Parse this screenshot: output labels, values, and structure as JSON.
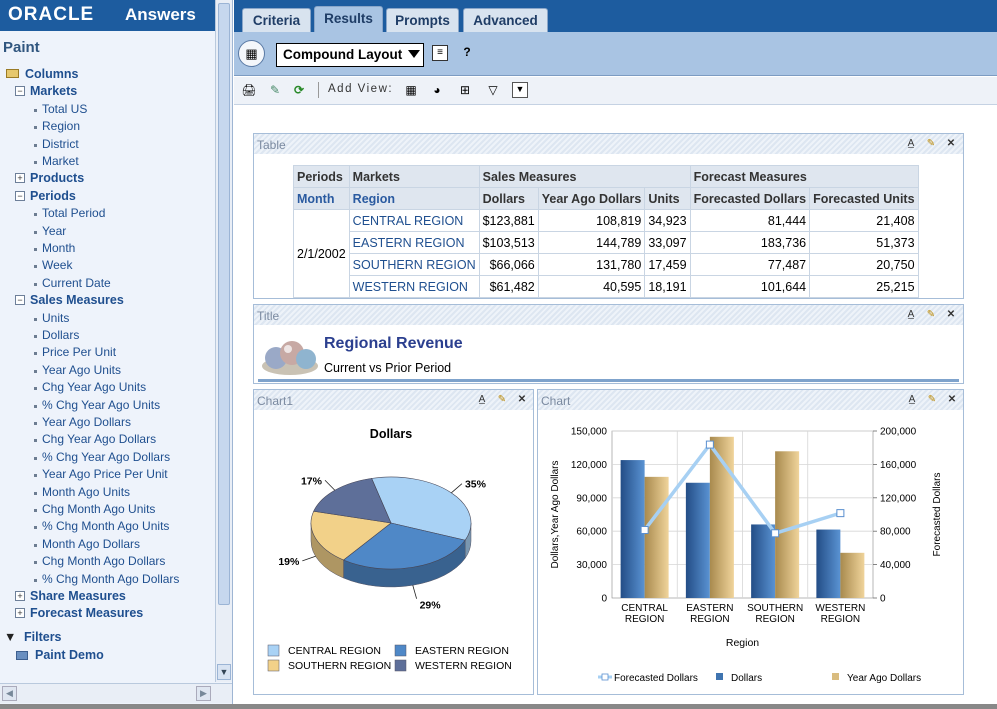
{
  "brand": {
    "oracle": "ORACLE",
    "product": "Answers"
  },
  "subject_area": "Paint",
  "tree": [
    {
      "label": "Columns",
      "level": 0,
      "kind": "folder"
    },
    {
      "label": "Markets",
      "level": 1,
      "kind": "minus"
    },
    {
      "label": "Total US",
      "level": 2,
      "kind": "leaf"
    },
    {
      "label": "Region",
      "level": 2,
      "kind": "leaf"
    },
    {
      "label": "District",
      "level": 2,
      "kind": "leaf"
    },
    {
      "label": "Market",
      "level": 2,
      "kind": "leaf"
    },
    {
      "label": "Products",
      "level": 1,
      "kind": "plus"
    },
    {
      "label": "Periods",
      "level": 1,
      "kind": "minus"
    },
    {
      "label": "Total Period",
      "level": 2,
      "kind": "leaf"
    },
    {
      "label": "Year",
      "level": 2,
      "kind": "leaf"
    },
    {
      "label": "Month",
      "level": 2,
      "kind": "leaf"
    },
    {
      "label": "Week",
      "level": 2,
      "kind": "leaf"
    },
    {
      "label": "Current Date",
      "level": 2,
      "kind": "leaf"
    },
    {
      "label": "Sales Measures",
      "level": 1,
      "kind": "minus"
    },
    {
      "label": "Units",
      "level": 2,
      "kind": "leaf"
    },
    {
      "label": "Dollars",
      "level": 2,
      "kind": "leaf"
    },
    {
      "label": "Price Per Unit",
      "level": 2,
      "kind": "leaf"
    },
    {
      "label": "Year Ago Units",
      "level": 2,
      "kind": "leaf"
    },
    {
      "label": "Chg Year Ago Units",
      "level": 2,
      "kind": "leaf"
    },
    {
      "label": "% Chg Year Ago Units",
      "level": 2,
      "kind": "leaf"
    },
    {
      "label": "Year Ago Dollars",
      "level": 2,
      "kind": "leaf"
    },
    {
      "label": "Chg Year Ago Dollars",
      "level": 2,
      "kind": "leaf"
    },
    {
      "label": "% Chg Year Ago Dollars",
      "level": 2,
      "kind": "leaf"
    },
    {
      "label": "Year Ago Price Per Unit",
      "level": 2,
      "kind": "leaf"
    },
    {
      "label": "Month Ago Units",
      "level": 2,
      "kind": "leaf"
    },
    {
      "label": "Chg Month Ago Units",
      "level": 2,
      "kind": "leaf"
    },
    {
      "label": "% Chg Month Ago Units",
      "level": 2,
      "kind": "leaf"
    },
    {
      "label": "Month Ago Dollars",
      "level": 2,
      "kind": "leaf"
    },
    {
      "label": "Chg Month Ago Dollars",
      "level": 2,
      "kind": "leaf"
    },
    {
      "label": "% Chg Month Ago Dollars",
      "level": 2,
      "kind": "leaf"
    },
    {
      "label": "Share Measures",
      "level": 1,
      "kind": "plus"
    },
    {
      "label": "Forecast Measures",
      "level": 1,
      "kind": "plus"
    }
  ],
  "filters": {
    "label": "Filters",
    "item": "Paint Demo"
  },
  "tabs": [
    "Criteria",
    "Results",
    "Prompts",
    "Advanced"
  ],
  "active_tab": "Results",
  "layout_select": "Compound Layout",
  "add_view_label": "Add View:",
  "table_view": {
    "title": "Table",
    "header1": [
      "Periods",
      "Markets",
      "Sales Measures",
      "Forecast Measures"
    ],
    "header2": [
      "Month",
      "Region",
      "Dollars",
      "Year Ago Dollars",
      "Units",
      "Forecasted Dollars",
      "Forecasted Units"
    ],
    "period": "2/1/2002",
    "rows": [
      {
        "region": "CENTRAL REGION",
        "dollars": "$123,881",
        "yad": "108,819",
        "units": "34,923",
        "fd": "81,444",
        "fu": "21,408"
      },
      {
        "region": "EASTERN REGION",
        "dollars": "$103,513",
        "yad": "144,789",
        "units": "33,097",
        "fd": "183,736",
        "fu": "51,373"
      },
      {
        "region": "SOUTHERN REGION",
        "dollars": "$66,066",
        "yad": "131,780",
        "units": "17,459",
        "fd": "77,487",
        "fu": "20,750"
      },
      {
        "region": "WESTERN REGION",
        "dollars": "$61,482",
        "yad": "40,595",
        "units": "18,191",
        "fd": "101,644",
        "fu": "25,215"
      }
    ]
  },
  "title_view": {
    "title": "Title",
    "main": "Regional Revenue",
    "sub": "Current vs Prior Period"
  },
  "chart1_title": "Chart1",
  "chart2_title": "Chart",
  "colors": {
    "central": "#a9d2f5",
    "eastern": "#4f88c7",
    "southern": "#f2d189",
    "western": "#5e6f99",
    "line": "#a7d0f3",
    "dollars": "#3f74b0",
    "yago": "#d9bc7f"
  },
  "chart_data": [
    {
      "type": "pie",
      "title": "Dollars",
      "labels": [
        "CENTRAL REGION",
        "EASTERN REGION",
        "SOUTHERN REGION",
        "WESTERN REGION"
      ],
      "values": [
        35,
        29,
        19,
        17
      ],
      "value_labels": [
        "35%",
        "29%",
        "19%",
        "17%"
      ],
      "legend": "bottom"
    },
    {
      "type": "bar",
      "categories": [
        "CENTRAL REGION",
        "EASTERN REGION",
        "SOUTHERN REGION",
        "WESTERN REGION"
      ],
      "series": [
        {
          "name": "Dollars",
          "values": [
            123881,
            103513,
            66066,
            61482
          ],
          "axis": "left"
        },
        {
          "name": "Year Ago Dollars",
          "values": [
            108819,
            144789,
            131780,
            40595
          ],
          "axis": "left"
        },
        {
          "name": "Forecasted Dollars",
          "values": [
            81444,
            183736,
            77487,
            101644
          ],
          "axis": "right",
          "style": "line"
        }
      ],
      "xlabel": "Region",
      "ylabel": "Dollars,Year Ago Dollars",
      "y2label": "Forecasted Dollars",
      "ylim": [
        0,
        150000
      ],
      "y2lim": [
        0,
        200000
      ],
      "yticks": [
        "0",
        "30,000",
        "60,000",
        "90,000",
        "120,000",
        "150,000"
      ],
      "y2ticks": [
        "0",
        "40,000",
        "80,000",
        "120,000",
        "160,000",
        "200,000"
      ],
      "grid": true,
      "legend": "bottom"
    }
  ]
}
